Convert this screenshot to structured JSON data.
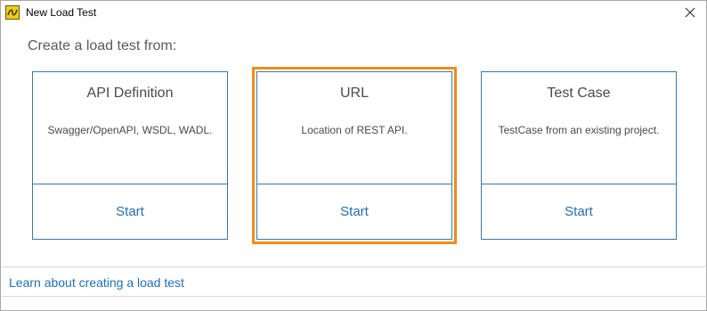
{
  "window": {
    "title": "New Load Test",
    "icon": "soapui-loadui-icon",
    "close_icon": "close-icon"
  },
  "heading": "Create a load test from:",
  "cards": [
    {
      "title": "API Definition",
      "description": "Swagger/OpenAPI, WSDL, WADL.",
      "start_label": "Start",
      "selected": false
    },
    {
      "title": "URL",
      "description": "Location of REST API.",
      "start_label": "Start",
      "selected": true
    },
    {
      "title": "Test Case",
      "description": "TestCase from an existing project.",
      "start_label": "Start",
      "selected": false
    }
  ],
  "footer": {
    "learn_link": "Learn about creating a load test"
  },
  "colors": {
    "accent": "#1f6fb0",
    "card_border": "#3a78a8",
    "selection": "#f08c1a"
  }
}
